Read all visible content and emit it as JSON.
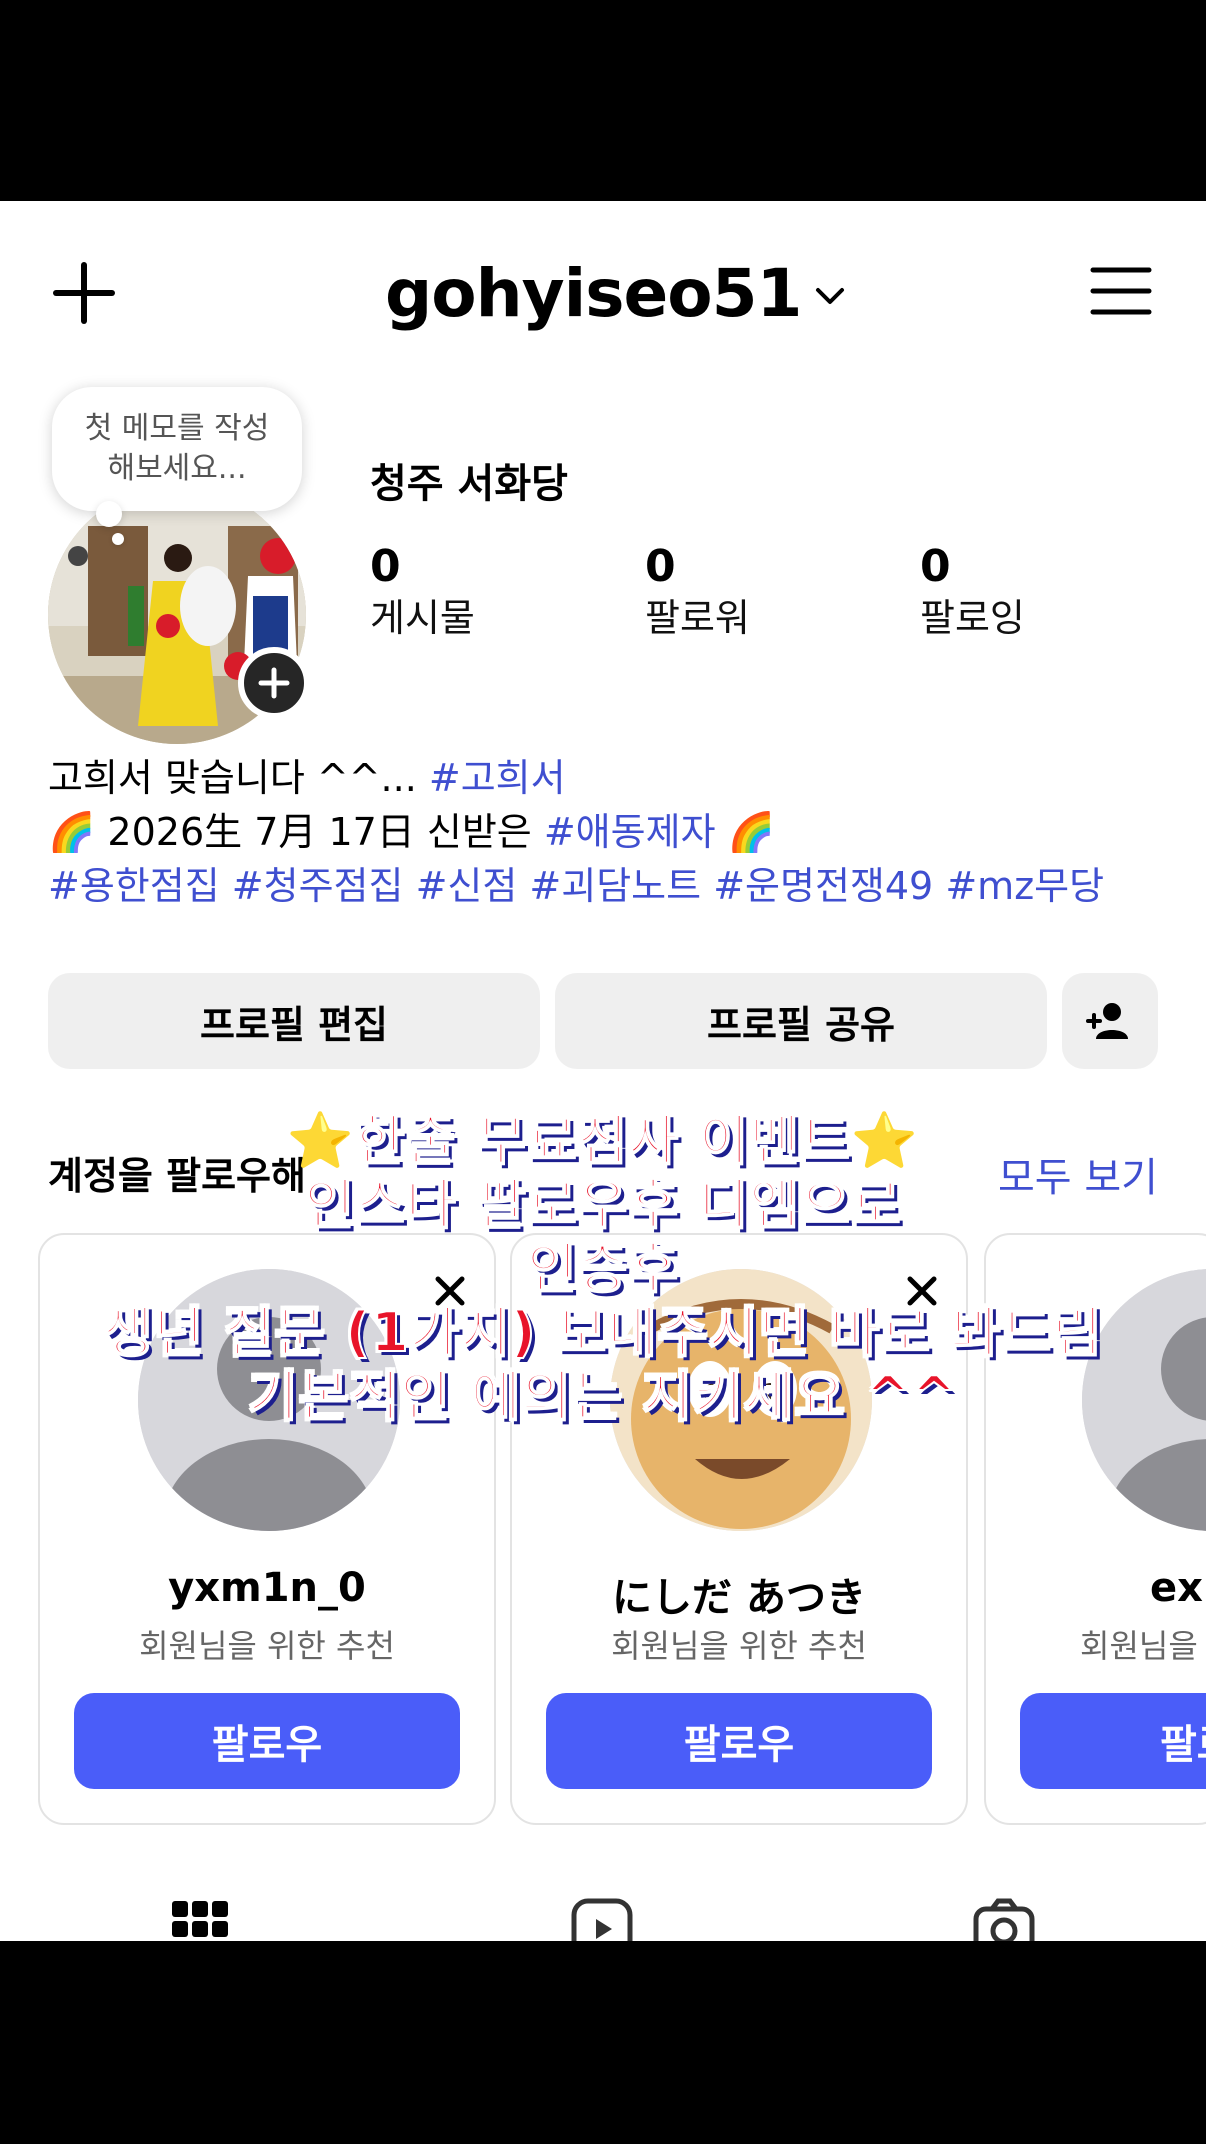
{
  "header": {
    "username": "gohyiseo51",
    "icons": {
      "new": "plus-icon",
      "switch": "chevron-down-icon",
      "menu": "hamburger-menu-icon"
    }
  },
  "profile": {
    "note": "첫 메모를 작성 해보세요...",
    "display_name": "청주 서화당",
    "stats": [
      {
        "value": "0",
        "label": "게시물"
      },
      {
        "value": "0",
        "label": "팔로워"
      },
      {
        "value": "0",
        "label": "팔로잉"
      }
    ],
    "bio": {
      "line1_text": "고희서 맞습니다 ^^... ",
      "line1_tag": "#고희서",
      "line2_emoji": "🌈",
      "line2_text": " 2026生 7月 17日 신받은 ",
      "line2_tag": "#애동제자",
      "line2_emoji_end": " 🌈",
      "line3_tags": [
        "#용한점집",
        "#청주점집",
        "#신점",
        "#괴담노트",
        "#운명전쟁49",
        "#mz무당"
      ]
    }
  },
  "actions": {
    "edit_profile": "프로필 편집",
    "share_profile": "프로필 공유",
    "discover_icon": "add-person-icon"
  },
  "suggestions": {
    "title": "계정을 팔로우해",
    "see_all": "모두 보기",
    "cards": [
      {
        "name": "yxm1n_0",
        "subtitle": "회원님을 위한 추천",
        "follow": "팔로우"
      },
      {
        "name": "にしだ あつき",
        "subtitle": "회원님을 위한 추천",
        "follow": "팔로우"
      },
      {
        "name": "exp",
        "subtitle": "회원님을",
        "follow": "팔로"
      }
    ]
  },
  "overlay": {
    "line1": "한줄 무료점사 이벤트",
    "line2": "인스타 팔로우후 디엠으로",
    "line3": "인증후",
    "line4": "생년 질문 (1가지) 보내주시면 바로 봐드림",
    "line5": "기본적인 예의는 지키세요 ^^",
    "star": "⭐",
    "colors": {
      "fill": "#e8142a",
      "outline": "#ffffff",
      "shadow": "#1d1f8e"
    }
  },
  "tabs": [
    "grid-icon",
    "reels-icon",
    "tagged-icon"
  ],
  "colors": {
    "accent": "#4a5df9",
    "link": "#3f4fd0",
    "button_bg": "#efefef"
  }
}
